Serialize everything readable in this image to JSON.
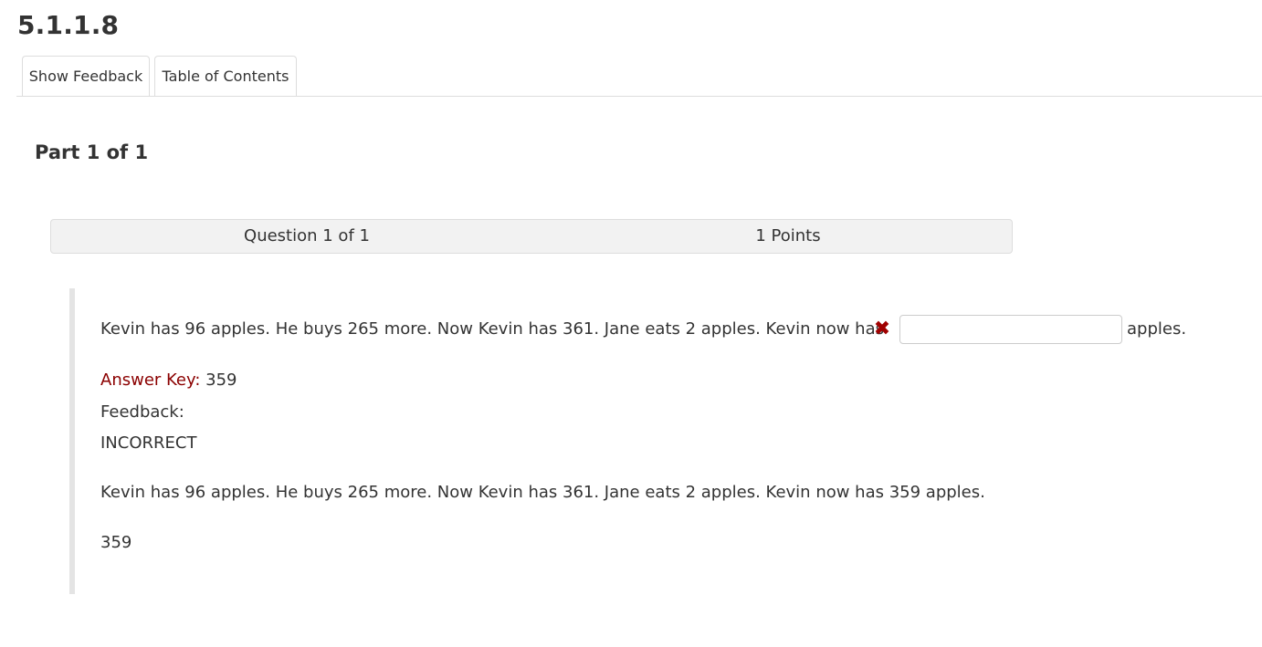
{
  "page": {
    "title": "5.1.1.8"
  },
  "tabs": {
    "show_feedback": "Show Feedback",
    "table_of_contents": "Table of Contents"
  },
  "part": {
    "title": "Part 1 of 1"
  },
  "question_header": {
    "count": "Question 1 of 1",
    "points": "1 Points"
  },
  "question": {
    "prompt": "Kevin has 96 apples. He buys 265 more. Now Kevin has 361. Jane eats 2 apples. Kevin now has",
    "status_icon": "incorrect-x-icon",
    "answer_value": "",
    "after_input": "apples."
  },
  "answer_key": {
    "label": "Answer Key:",
    "value": "359"
  },
  "feedback": {
    "label": "Feedback:",
    "result": "INCORRECT",
    "explanation": "Kevin has 96 apples. He buys 265 more. Now Kevin has 361. Jane eats 2 apples. Kevin now has 359 apples.",
    "final_answer": "359"
  },
  "colors": {
    "incorrect_icon": "#a00000",
    "answer_key_label": "#8b0000",
    "question_bar_bg": "#f2f2f2",
    "block_border": "#e4e4e4"
  }
}
